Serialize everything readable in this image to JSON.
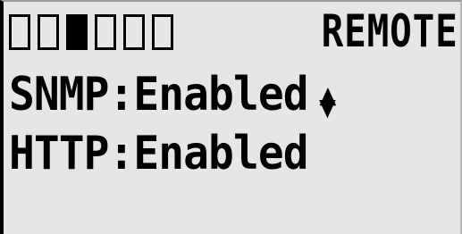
{
  "status_bar": {
    "blocks": [
      false,
      false,
      true,
      false,
      false,
      false
    ],
    "mode_label": "REMOTE"
  },
  "lines": {
    "snmp": "SNMP:Enabled",
    "http": "HTTP:Enabled"
  },
  "icons": {
    "scroll_indicator": "up-down-arrow-icon"
  }
}
